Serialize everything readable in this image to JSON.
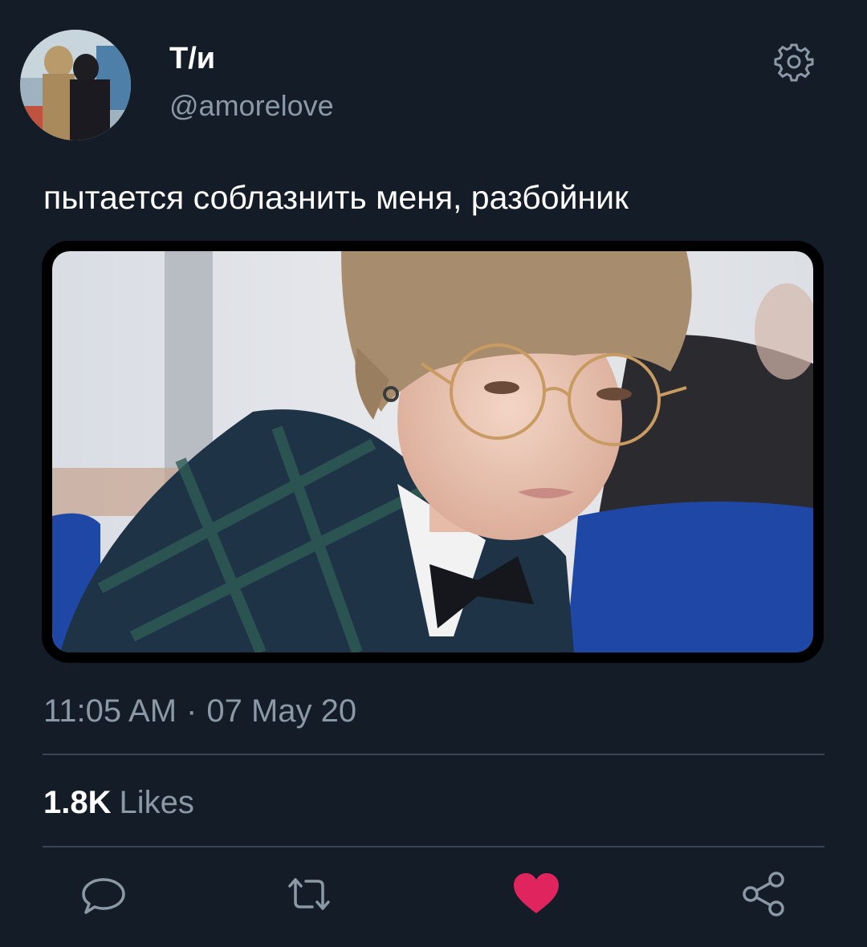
{
  "user": {
    "display_name": "Т/и",
    "handle": "@amorelove"
  },
  "tweet": {
    "text": "пытается соблазнить меня, разбойник",
    "time": "11:05 AM",
    "separator": "·",
    "date": "07 May 20"
  },
  "stats": {
    "likes_count": "1.8K",
    "likes_label": "Likes"
  },
  "icons": {
    "settings": "gear-icon",
    "reply": "comment-icon",
    "retweet": "retweet-icon",
    "like": "heart-icon",
    "share": "share-icon"
  },
  "colors": {
    "background": "#141c27",
    "secondary_text": "#8b98a5",
    "like_active": "#e0245e",
    "divider": "#3a4654"
  }
}
